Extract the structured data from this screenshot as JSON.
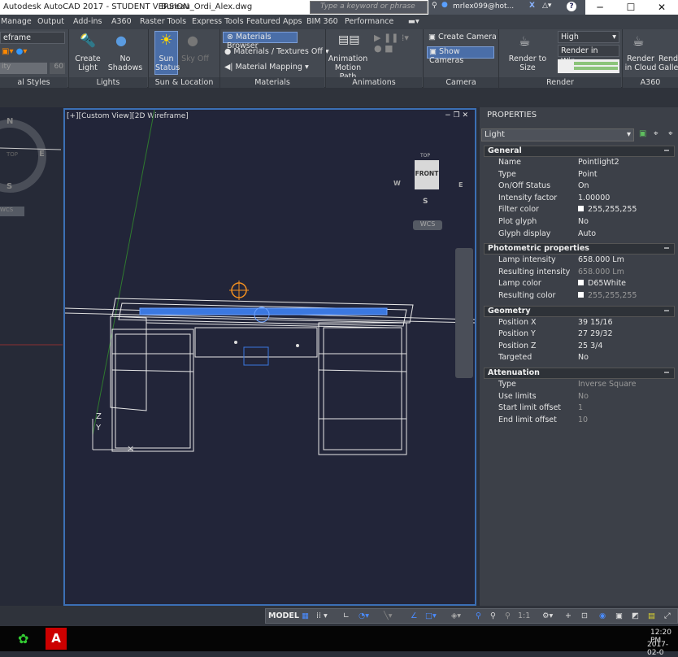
{
  "window": {
    "title": "Autodesk AutoCAD 2017 - STUDENT VERSION",
    "file": "Bureau_Ordi_Alex.dwg",
    "search_placeholder": "Type a keyword or phrase",
    "user": "mrlex099@hot...",
    "controls": [
      "─",
      "☐",
      "✕"
    ]
  },
  "tabs": [
    "Manage",
    "Output",
    "Add-ins",
    "A360",
    "Raster Tools",
    "Express Tools",
    "Featured Apps",
    "BIM 360",
    "Performance"
  ],
  "ribbon": {
    "visual_styles": {
      "dropdown": "eframe",
      "slider_label": "ity",
      "slider_value": "60",
      "title": "al Styles"
    },
    "lights": {
      "create_light": "Create Light",
      "no_shadows": "No Shadows",
      "title": "Lights"
    },
    "sun": {
      "sun_status": "Sun Status",
      "sky_off": "Sky Off",
      "title": "Sun & Location"
    },
    "materials": {
      "browser": "Materials Browser",
      "textures": "Materials / Textures Off",
      "mapping": "Material Mapping",
      "title": "Materials"
    },
    "animations": {
      "motion_path": "Animation Motion Path",
      "title": "Animations"
    },
    "camera": {
      "create": "Create Camera",
      "show": "Show  Cameras",
      "title": "Camera"
    },
    "render": {
      "render_to_size": "Render to Size",
      "quality": "High",
      "render_in": "Render in Win...",
      "title": "Render"
    },
    "a360": {
      "cloud": "Render in Cloud",
      "gallery": "Render Gallery",
      "title": "A360"
    }
  },
  "viewport": {
    "label": "[+][Custom View][2D Wireframe]",
    "viewcube_face": "FRONT",
    "viewcube_top": "TOP",
    "compass": {
      "n": "N",
      "s": "S",
      "e": "E",
      "w": "W"
    },
    "wcs": "WCS",
    "left_compass": {
      "n": "N",
      "s": "S",
      "e": "E",
      "top": "TOP"
    },
    "ucs": {
      "z": "Z",
      "y": "Y"
    }
  },
  "properties": {
    "title": "PROPERTIES",
    "selector": "Light",
    "sections": [
      {
        "title": "General",
        "rows": [
          [
            "Name",
            "Pointlight2"
          ],
          [
            "Type",
            "Point"
          ],
          [
            "On/Off Status",
            "On"
          ],
          [
            "Intensity factor",
            "1.00000"
          ],
          [
            "Filter color",
            "255,255,255"
          ],
          [
            "Plot glyph",
            "No"
          ],
          [
            "Glyph display",
            "Auto"
          ]
        ]
      },
      {
        "title": "Photometric properties",
        "rows": [
          [
            "Lamp intensity",
            "658.000 Lm"
          ],
          [
            "Resulting intensity",
            "658.000 Lm"
          ],
          [
            "Lamp color",
            "D65White"
          ],
          [
            "Resulting color",
            "255,255,255"
          ]
        ]
      },
      {
        "title": "Geometry",
        "rows": [
          [
            "Position X",
            "39 15/16"
          ],
          [
            "Position Y",
            "27 29/32"
          ],
          [
            "Position Z",
            "25 3/4"
          ],
          [
            "Targeted",
            "No"
          ]
        ]
      },
      {
        "title": "Attenuation",
        "rows": [
          [
            "Type",
            "Inverse Square"
          ],
          [
            "Use limits",
            "No"
          ],
          [
            "Start limit offset",
            "1"
          ],
          [
            "End limit offset",
            "10"
          ]
        ]
      }
    ]
  },
  "statusbar": {
    "model": "MODEL",
    "scale": "1:1"
  },
  "taskbar": {
    "time": "12:20 PM",
    "date": "2017-02-0"
  },
  "colors": {
    "accent": "#3b6fb5",
    "highlight": "#4a6ea8",
    "viewport_bg": "#222539"
  }
}
